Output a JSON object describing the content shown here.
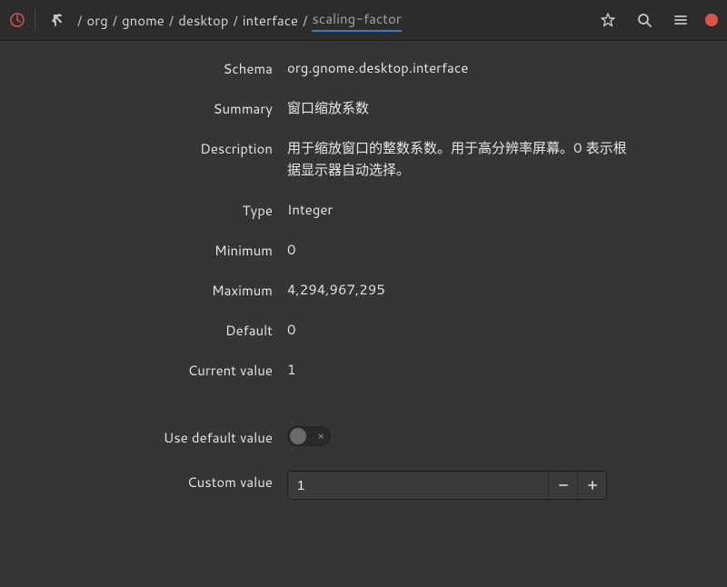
{
  "breadcrumb": {
    "segments": [
      "org",
      "gnome",
      "desktop",
      "interface"
    ],
    "current": "scaling-factor"
  },
  "labels": {
    "schema": "Schema",
    "summary": "Summary",
    "description": "Description",
    "type": "Type",
    "minimum": "Minimum",
    "maximum": "Maximum",
    "default_": "Default",
    "current_value": "Current value",
    "use_default": "Use default value",
    "custom_value": "Custom value"
  },
  "values": {
    "schema": "org.gnome.desktop.interface",
    "summary": "窗口缩放系数",
    "description": "用于缩放窗口的整数系数。用于高分辨率屏幕。0 表示根据显示器自动选择。",
    "type": "Integer",
    "minimum": "0",
    "maximum": "4,294,967,295",
    "default_": "0",
    "current_value": "1",
    "use_default": false,
    "custom_value": "1"
  }
}
